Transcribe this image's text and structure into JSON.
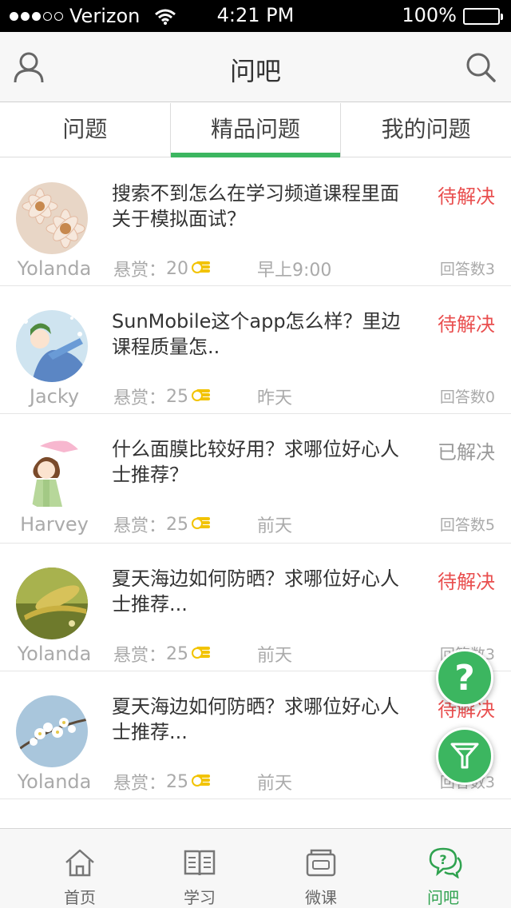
{
  "status_bar": {
    "carrier": "Verizon",
    "signal_bars_filled": 3,
    "signal_bars_total": 5,
    "time": "4:21 PM",
    "battery": "100%"
  },
  "nav": {
    "title": "问吧"
  },
  "tabs": [
    {
      "label": "问题",
      "active": false
    },
    {
      "label": "精品问题",
      "active": true
    },
    {
      "label": "我的问题",
      "active": false
    }
  ],
  "questions": [
    {
      "author": "Yolanda",
      "text": "搜索不到怎么在学习频道课程里面关于模拟面试？",
      "status": "待解决",
      "status_type": "pending",
      "reward_label": "悬赏：",
      "reward": "20",
      "time": "早上9:00",
      "answers": "回答数3",
      "avatar_icon": "flower-photo"
    },
    {
      "author": "Jacky",
      "text": "SunMobile这个app怎么样？里边课程质量怎..",
      "status": "待解决",
      "status_type": "pending",
      "reward_label": "悬赏：",
      "reward": "25",
      "time": "昨天",
      "answers": "回答数0",
      "avatar_icon": "cartoon-boy"
    },
    {
      "author": "Harvey",
      "text": "什么面膜比较好用？求哪位好心人士推荐？",
      "status": "已解决",
      "status_type": "solved",
      "reward_label": "悬赏：",
      "reward": "25",
      "time": "前天",
      "answers": "回答数5",
      "avatar_icon": "cartoon-girl"
    },
    {
      "author": "Yolanda",
      "text": "夏天海边如何防晒？求哪位好心人士推荐...",
      "status": "待解决",
      "status_type": "pending",
      "reward_label": "悬赏：",
      "reward": "25",
      "time": "前天",
      "answers": "回答数3",
      "avatar_icon": "nature-photo"
    },
    {
      "author": "Yolanda",
      "text": "夏天海边如何防晒？求哪位好心人士推荐...",
      "status": "待解决",
      "status_type": "pending",
      "reward_label": "悬赏：",
      "reward": "25",
      "time": "前天",
      "answers": "回答数3",
      "avatar_icon": "blossom-photo"
    }
  ],
  "fab": {
    "ask_symbol": "?",
    "ask_icon": "question-icon",
    "filter_icon": "filter-icon"
  },
  "tabbar": [
    {
      "label": "首页",
      "icon": "home-icon",
      "active": false
    },
    {
      "label": "学习",
      "icon": "book-icon",
      "active": false
    },
    {
      "label": "微课",
      "icon": "video-course-icon",
      "active": false
    },
    {
      "label": "问吧",
      "icon": "chat-question-icon",
      "active": true
    }
  ],
  "colors": {
    "accent": "#3cb660",
    "pending": "#e94e4e",
    "muted": "#aaaaaa"
  }
}
